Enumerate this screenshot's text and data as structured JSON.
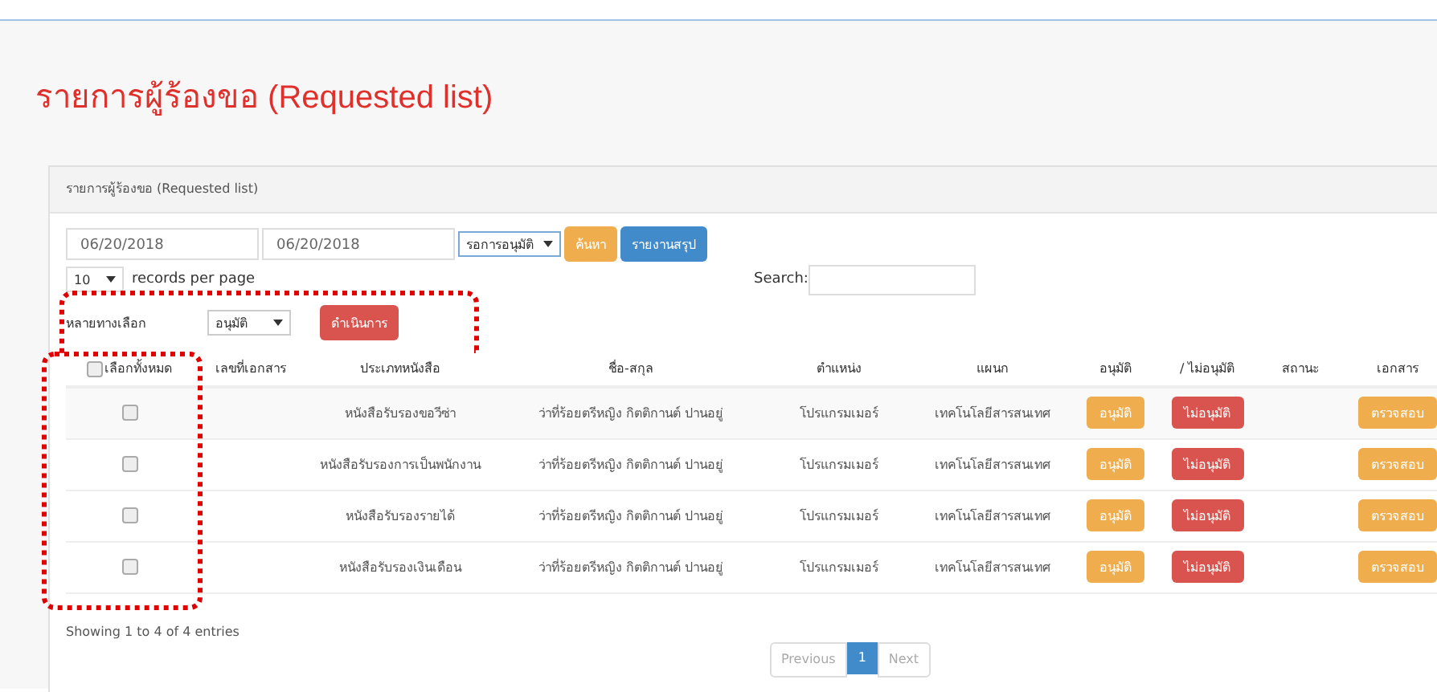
{
  "page_title": "รายการผู้ร้องขอ (Requested list)",
  "panel": {
    "title": "รายการผู้ร้องขอ (Requested list)"
  },
  "filters": {
    "date_from": "06/20/2018",
    "date_to": "06/20/2018",
    "status_select": "รอการอนุมัติ",
    "search_button": "ค้นหา",
    "report_button": "รายงานสรุป"
  },
  "page_length": {
    "value": "10",
    "label": "records per page"
  },
  "search": {
    "label": "Search:"
  },
  "bulk": {
    "label": "หลายทางเลือก",
    "select": "อนุมัติ",
    "button": "ดำเนินการ"
  },
  "table": {
    "select_all": {
      "label": "เลือกทั้งหมด",
      "checked": false
    },
    "columns": [
      "เลขที่เอกสาร",
      "ประเภทหนังสือ",
      "ชื่อ-สกุล",
      "ตำแหน่ง",
      "แผนก",
      "อนุมัติ",
      "/ ไม่อนุมัติ",
      "สถานะ",
      "เอกสาร"
    ],
    "rows": [
      {
        "checked": false,
        "doc_no": "",
        "type": "หนังสือรับรองขอวีซ่า",
        "name": "ว่าที่ร้อยตรีหญิง กิตติกานต์ ปานอยู่",
        "position": "โปรแกรมเมอร์",
        "department": "เทคโนโลยีสารสนเทศ",
        "approve": "อนุมัติ",
        "reject": "ไม่อนุมัติ",
        "status": "",
        "document": "ตรวจสอบ"
      },
      {
        "checked": false,
        "doc_no": "",
        "type": "หนังสือรับรองการเป็นพนักงาน",
        "name": "ว่าที่ร้อยตรีหญิง กิตติกานต์ ปานอยู่",
        "position": "โปรแกรมเมอร์",
        "department": "เทคโนโลยีสารสนเทศ",
        "approve": "อนุมัติ",
        "reject": "ไม่อนุมัติ",
        "status": "",
        "document": "ตรวจสอบ"
      },
      {
        "checked": false,
        "doc_no": "",
        "type": "หนังสือรับรองรายได้",
        "name": "ว่าที่ร้อยตรีหญิง กิตติกานต์ ปานอยู่",
        "position": "โปรแกรมเมอร์",
        "department": "เทคโนโลยีสารสนเทศ",
        "approve": "อนุมัติ",
        "reject": "ไม่อนุมัติ",
        "status": "",
        "document": "ตรวจสอบ"
      },
      {
        "checked": false,
        "doc_no": "",
        "type": "หนังสือรับรองเงินเดือน",
        "name": "ว่าที่ร้อยตรีหญิง กิตติกานต์ ปานอยู่",
        "position": "โปรแกรมเมอร์",
        "department": "เทคโนโลยีสารสนเทศ",
        "approve": "อนุมัติ",
        "reject": "ไม่อนุมัติ",
        "status": "",
        "document": "ตรวจสอบ"
      }
    ]
  },
  "info": "Showing 1 to 4 of 4 entries",
  "pagination": [
    {
      "label": "Previous",
      "kind": "prev",
      "selected": false,
      "disabled": true
    },
    {
      "label": "1",
      "kind": "page",
      "selected": true,
      "disabled": false
    },
    {
      "label": "Next",
      "kind": "next",
      "selected": false,
      "disabled": true
    }
  ]
}
